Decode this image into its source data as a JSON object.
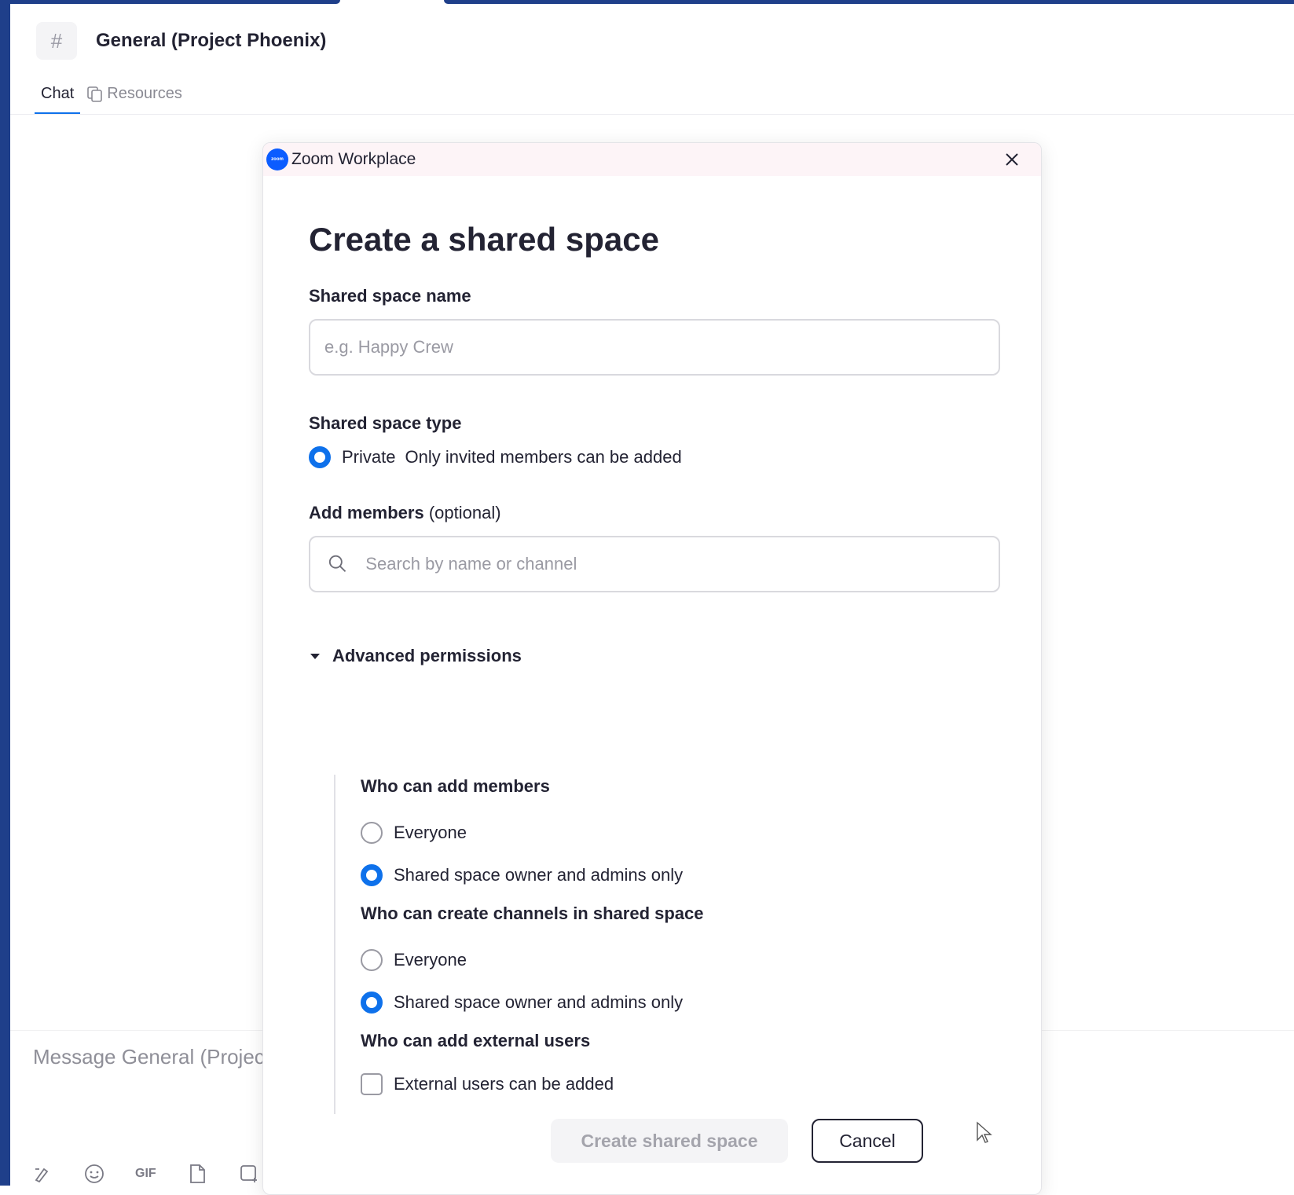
{
  "channel": {
    "hash_symbol": "#",
    "title": "General (Project Phoenix)",
    "tabs": [
      {
        "label": "Chat",
        "active": true
      },
      {
        "label": "Resources",
        "active": false
      }
    ]
  },
  "composer": {
    "placeholder": "Message General (Projec",
    "tools": [
      "format-icon",
      "emoji-icon",
      "gif-icon",
      "file-icon",
      "screenshot-icon"
    ],
    "gif_label": "GIF"
  },
  "dialog": {
    "app_title": "Zoom Workplace",
    "app_logo_text": "zoom",
    "heading": "Create a shared space",
    "name_field": {
      "label": "Shared space name",
      "placeholder": "e.g. Happy Crew",
      "value": ""
    },
    "type_field": {
      "label": "Shared space type",
      "option_label": "Private",
      "option_desc": "Only invited members can be added",
      "selected": true
    },
    "members_field": {
      "label": "Add members",
      "label_suffix": "(optional)",
      "placeholder": "Search by name or channel"
    },
    "advanced": {
      "label": "Advanced permissions",
      "expanded": true,
      "add_members": {
        "label": "Who can add members",
        "options": [
          {
            "label": "Everyone",
            "selected": false
          },
          {
            "label": "Shared space owner and admins only",
            "selected": true
          }
        ]
      },
      "create_channels": {
        "label": "Who can create channels in shared space",
        "options": [
          {
            "label": "Everyone",
            "selected": false
          },
          {
            "label": "Shared space owner and admins only",
            "selected": true
          }
        ]
      },
      "external_users": {
        "label": "Who can add external users",
        "checkbox_label": "External users can be added",
        "checked": false
      }
    },
    "buttons": {
      "create": "Create shared space",
      "cancel": "Cancel"
    }
  },
  "colors": {
    "accent": "#0e71eb",
    "sidebar": "#1f3f8a",
    "titlebar": "#fdf4f7"
  }
}
